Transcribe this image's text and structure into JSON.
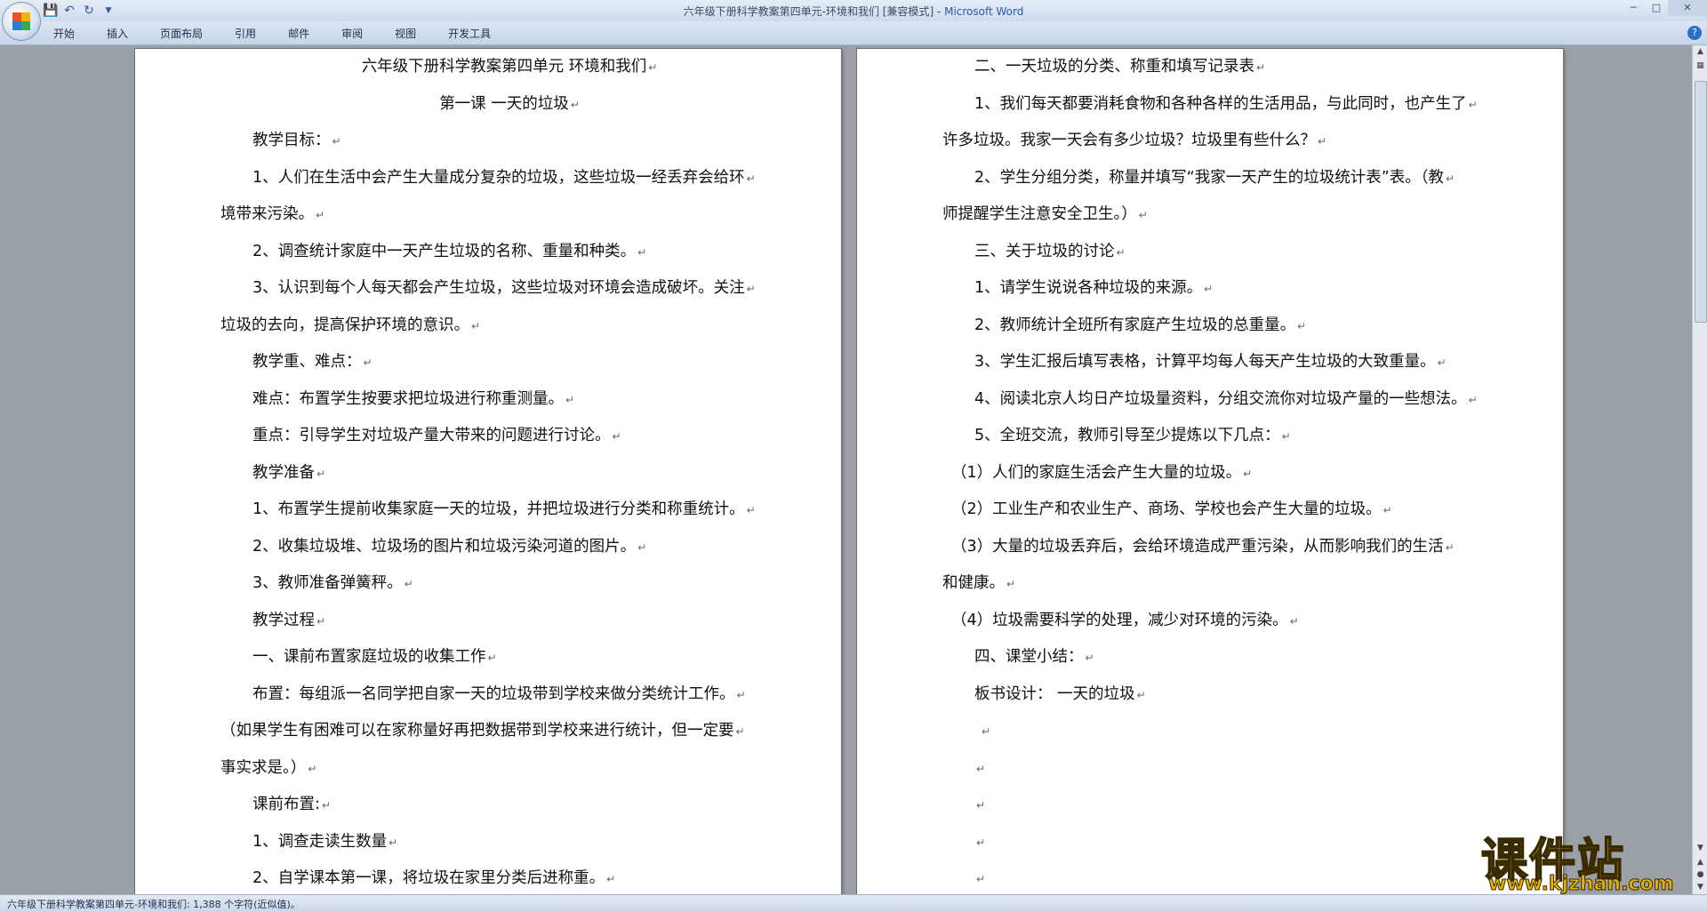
{
  "window": {
    "title_doc": "六年级下册科学教案第四单元-环境和我们 [兼容模式] - ",
    "title_app": "Microsoft Word"
  },
  "ribbon": {
    "tabs": [
      "开始",
      "插入",
      "页面布局",
      "引用",
      "邮件",
      "审阅",
      "视图",
      "开发工具"
    ]
  },
  "page_left": {
    "lines": [
      {
        "text": "六年级下册科学教案第四单元  环境和我们",
        "style": "center"
      },
      {
        "text": "第一课      一天的垃圾",
        "style": "center"
      },
      {
        "text": "教学目标：",
        "style": "indent"
      },
      {
        "text": "1、人们在生活中会产生大量成分复杂的垃圾，这些垃圾一经丢弃会给环",
        "style": "indent"
      },
      {
        "text": "境带来污染。",
        "style": "plain"
      },
      {
        "text": "2、调查统计家庭中一天产生垃圾的名称、重量和种类。",
        "style": "indent"
      },
      {
        "text": "3、认识到每个人每天都会产生垃圾，这些垃圾对环境会造成破坏。关注",
        "style": "indent"
      },
      {
        "text": "垃圾的去向，提高保护环境的意识。",
        "style": "plain"
      },
      {
        "text": "教学重、难点：",
        "style": "indent"
      },
      {
        "text": "难点：布置学生按要求把垃圾进行称重测量。",
        "style": "indent"
      },
      {
        "text": "重点：引导学生对垃圾产量大带来的问题进行讨论。",
        "style": "indent"
      },
      {
        "text": "教学准备",
        "style": "indent"
      },
      {
        "text": "1、布置学生提前收集家庭一天的垃圾，并把垃圾进行分类和称重统计。",
        "style": "indent"
      },
      {
        "text": "2、收集垃圾堆、垃圾场的图片和垃圾污染河道的图片。",
        "style": "indent"
      },
      {
        "text": "3、教师准备弹簧秤。",
        "style": "indent"
      },
      {
        "text": "教学过程",
        "style": "indent"
      },
      {
        "text": "一、课前布置家庭垃圾的收集工作",
        "style": "indent"
      },
      {
        "text": "布置：每组派一名同学把自家一天的垃圾带到学校来做分类统计工作。",
        "style": "indent"
      },
      {
        "text": "（如果学生有困难可以在家称量好再把数据带到学校来进行统计，但一定要",
        "style": "plain"
      },
      {
        "text": "事实求是。）",
        "style": "plain"
      },
      {
        "text": "课前布置:",
        "style": "indent"
      },
      {
        "text": "1、调查走读生数量",
        "style": "indent"
      },
      {
        "text": "2、自学课本第一课，将垃圾在家里分类后进称重。",
        "style": "indent"
      }
    ]
  },
  "page_right": {
    "lines": [
      {
        "text": "二、一天垃圾的分类、称重和填写记录表",
        "style": "indent"
      },
      {
        "text": "1、我们每天都要消耗食物和各种各样的生活用品，与此同时，也产生了",
        "style": "indent"
      },
      {
        "text": "许多垃圾。我家一天会有多少垃圾？垃圾里有些什么？",
        "style": "plain"
      },
      {
        "text": "2、学生分组分类，称量并填写“我家一天产生的垃圾统计表”表。（教",
        "style": "indent"
      },
      {
        "text": "师提醒学生注意安全卫生。）",
        "style": "plain"
      },
      {
        "text": "三、关于垃圾的讨论",
        "style": "indent"
      },
      {
        "text": "1、请学生说说各种垃圾的来源。",
        "style": "indent"
      },
      {
        "text": "2、教师统计全班所有家庭产生垃圾的总重量。",
        "style": "indent"
      },
      {
        "text": "3、学生汇报后填写表格，计算平均每人每天产生垃圾的大致重量。",
        "style": "indent"
      },
      {
        "text": "4、阅读北京人均日产垃圾量资料，分组交流你对垃圾产量的一些想法。",
        "style": "indent"
      },
      {
        "text": "5、全班交流，教师引导至少提炼以下几点：",
        "style": "indent"
      },
      {
        "text": "（1）人们的家庭生活会产生大量的垃圾。",
        "style": "pin"
      },
      {
        "text": "（2）工业生产和农业生产、商场、学校也会产生大量的垃圾。",
        "style": "pin"
      },
      {
        "text": "（3）大量的垃圾丢弃后，会给环境造成严重污染，从而影响我们的生活",
        "style": "pin"
      },
      {
        "text": "和健康。",
        "style": "plain"
      },
      {
        "text": "（4）垃圾需要科学的处理，减少对环境的污染。",
        "style": "pin"
      },
      {
        "text": "四、课堂小结：",
        "style": "indent"
      },
      {
        "text": "板书设计：  一天的垃圾",
        "style": "indent"
      },
      {
        "text": "",
        "style": "pin2"
      },
      {
        "text": "",
        "style": "indent"
      },
      {
        "text": "",
        "style": "indent"
      },
      {
        "text": "",
        "style": "indent"
      },
      {
        "text": "",
        "style": "indent"
      }
    ]
  },
  "statusbar": {
    "text": "六年级下册科学教案第四单元-环境和我们: 1,388 个字符(近似值)。"
  },
  "watermark": {
    "main": "课件站",
    "url": "www.kjzhan.com"
  },
  "icons": {
    "save": "save-icon",
    "undo": "undo-icon",
    "redo": "redo-icon",
    "customize": "customize-qat-icon"
  }
}
